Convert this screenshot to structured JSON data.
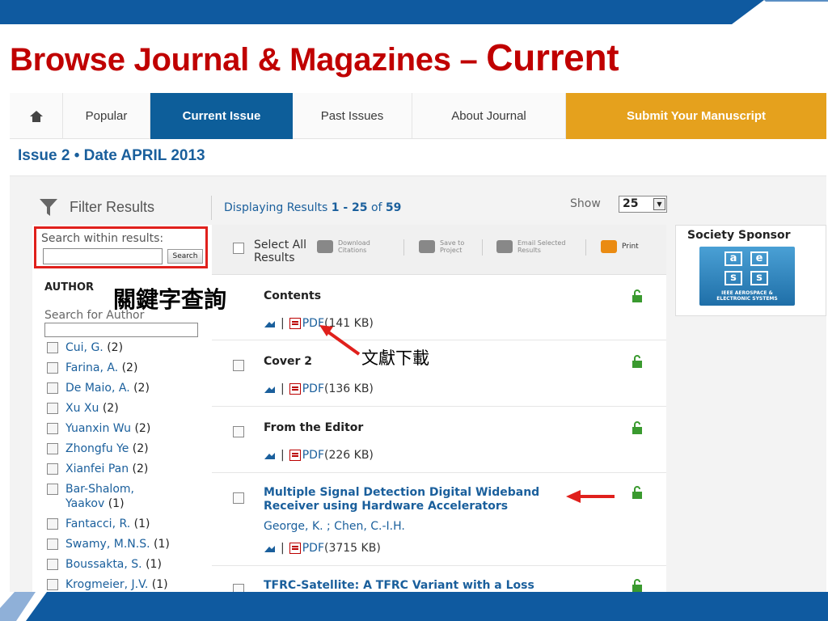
{
  "slide": {
    "title_main": "Browse Journal & Magazines – ",
    "title_emph": "Current",
    "annotation_keyword": "關鍵字查詢",
    "annotation_download": "文獻下載"
  },
  "nav": {
    "tabs": [
      {
        "label": "Popular"
      },
      {
        "label": "Current Issue"
      },
      {
        "label": "Past Issues"
      },
      {
        "label": "About Journal"
      },
      {
        "label": "Submit Your Manuscript"
      }
    ]
  },
  "issue": {
    "text": "Issue 2 • Date APRIL 2013"
  },
  "filter": {
    "label": "Filter Results"
  },
  "display": {
    "prefix": "Displaying Results ",
    "range": "1 - 25",
    "of": " of ",
    "total": "59"
  },
  "show": {
    "label": "Show",
    "value": "25"
  },
  "search": {
    "label": "Search within results:",
    "button": "Search"
  },
  "author": {
    "heading": "AUTHOR",
    "search_label": "Search for Author",
    "items": [
      {
        "name": "Cui, G.",
        "count": " (2)"
      },
      {
        "name": "Farina, A.",
        "count": " (2)"
      },
      {
        "name": "De Maio, A.",
        "count": " (2)"
      },
      {
        "name": "Xu Xu",
        "count": " (2)"
      },
      {
        "name": "Yuanxin Wu",
        "count": " (2)"
      },
      {
        "name": "Zhongfu Ye",
        "count": " (2)"
      },
      {
        "name": "Xianfei Pan",
        "count": " (2)"
      },
      {
        "name": "Bar-Shalom, Yaakov",
        "count": " (1)"
      },
      {
        "name": "Fantacci, R.",
        "count": " (1)"
      },
      {
        "name": "Swamy, M.N.S.",
        "count": " (1)"
      },
      {
        "name": "Boussakta, S.",
        "count": " (1)"
      },
      {
        "name": "Krogmeier, J.V.",
        "count": " (1)"
      }
    ]
  },
  "toolbar": {
    "select_all": "Select All Results",
    "download_l1": "Download",
    "download_l2": "Citations",
    "save_l1": "Save to",
    "save_l2": "Project",
    "email_l1": "Email Selected",
    "email_l2": "Results",
    "print": "Print"
  },
  "results": [
    {
      "title": "Contents",
      "authors": "",
      "sep": "|",
      "pdf": "PDF",
      "size": " (141 KB)"
    },
    {
      "title": "Cover 2",
      "authors": "",
      "sep": "|",
      "pdf": "PDF",
      "size": " (136 KB)"
    },
    {
      "title": "From the Editor",
      "authors": "",
      "sep": "|",
      "pdf": "PDF",
      "size": " (226 KB)"
    },
    {
      "title": "Multiple Signal Detection Digital Wideband Receiver using Hardware Accelerators",
      "authors": "George, K. ; Chen, C.-I.H.",
      "sep": "|",
      "pdf": "PDF",
      "size": " (3715 KB)"
    },
    {
      "title": "TFRC-Satellite: A TFRC Variant with a Loss",
      "authors": "",
      "sep": "",
      "pdf": "",
      "size": ""
    }
  ],
  "sponsor": {
    "title": "Society Sponsor",
    "logo_letters": [
      "a",
      "e",
      "s",
      "s"
    ],
    "logo_l1": "IEEE AEROSPACE &",
    "logo_l2": "ELECTRONIC SYSTEMS"
  },
  "colors": {
    "title_red": "#c00000",
    "nav_blue": "#0d5e9a",
    "submit_orange": "#e5a11d",
    "link_blue": "#1a5f9c",
    "annotation_red": "#e0201c",
    "band_blue": "#0f5aa0"
  }
}
